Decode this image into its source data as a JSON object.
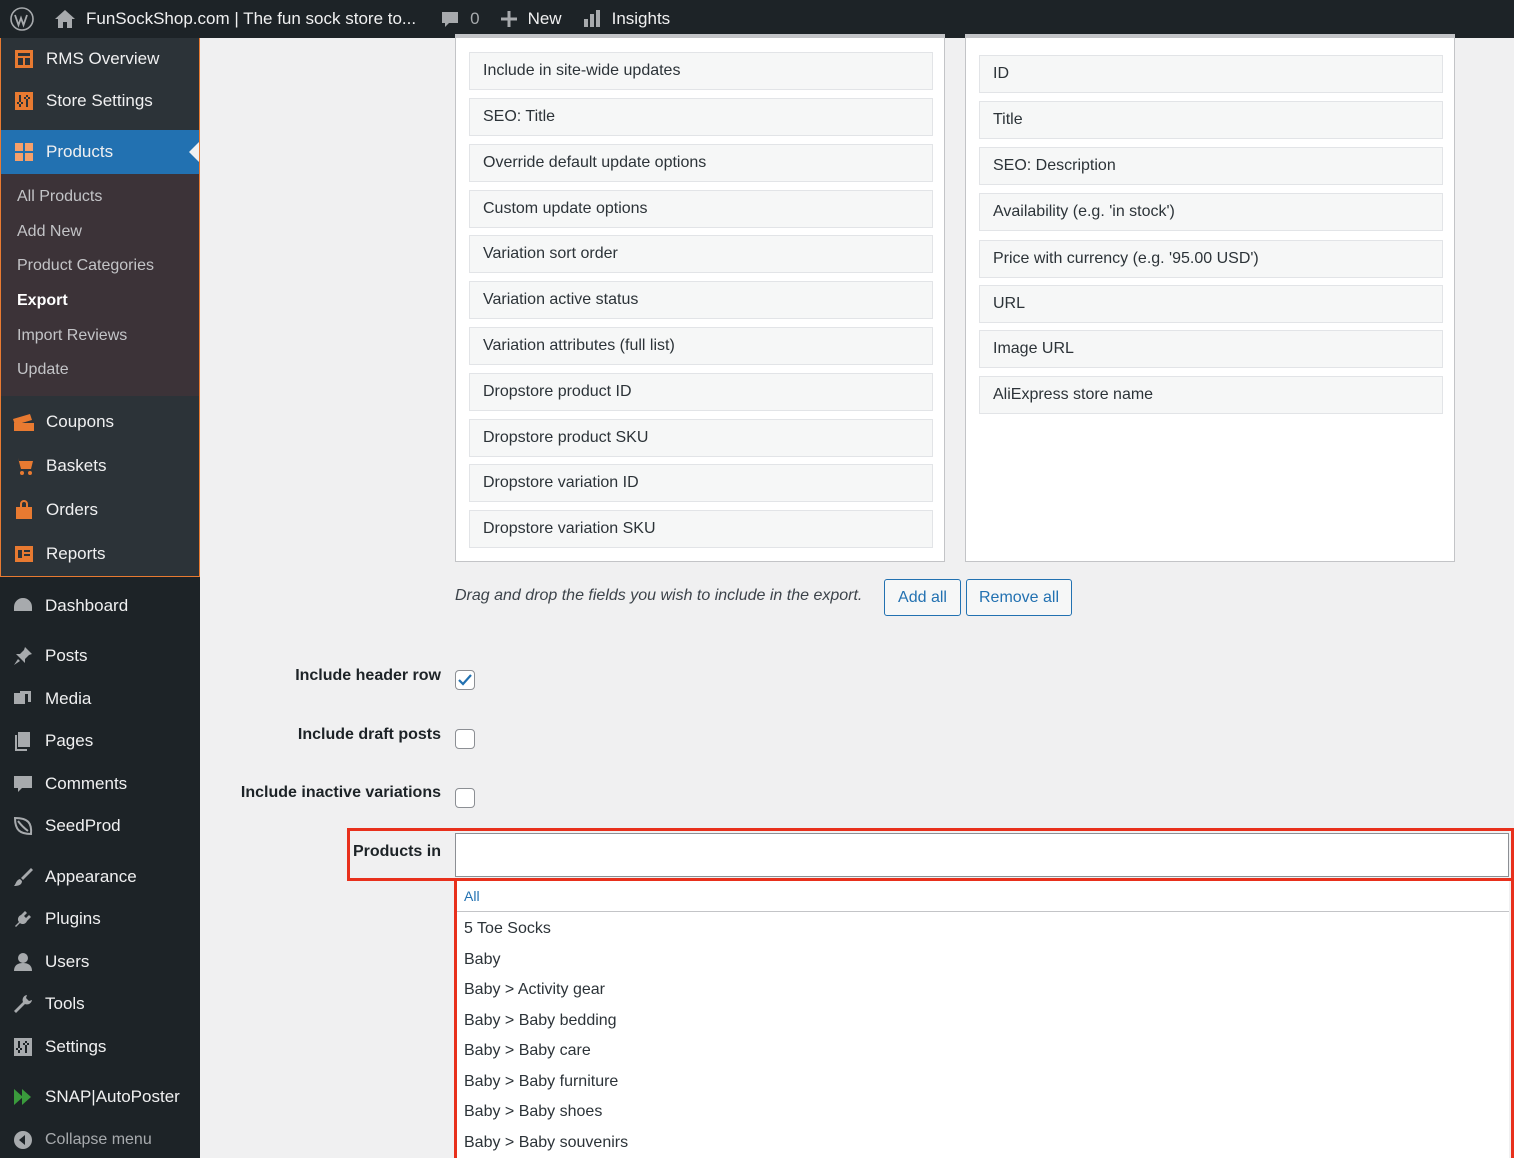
{
  "adminbar": {
    "site_title": "FunSockShop.com | The fun sock store to...",
    "comments_count": "0",
    "new_label": "New",
    "insights_label": "Insights"
  },
  "sidebar": {
    "rms_items": [
      {
        "label": "RMS Overview",
        "icon": "rms-overview-icon"
      },
      {
        "label": "Store Settings",
        "icon": "store-settings-icon"
      }
    ],
    "products": {
      "label": "Products",
      "submenu": [
        "All Products",
        "Add New",
        "Product Categories",
        "Export",
        "Import Reviews",
        "Update"
      ],
      "current_submenu": "Export"
    },
    "rms_items_after": [
      {
        "label": "Coupons",
        "icon": "coupons-icon"
      },
      {
        "label": "Baskets",
        "icon": "baskets-icon"
      },
      {
        "label": "Orders",
        "icon": "orders-icon"
      },
      {
        "label": "Reports",
        "icon": "reports-icon"
      }
    ],
    "wp_items": [
      "Dashboard",
      "Posts",
      "Media",
      "Pages",
      "Comments",
      "SeedProd",
      "Appearance",
      "Plugins",
      "Users",
      "Tools",
      "Settings",
      "SNAP|AutoPoster"
    ],
    "collapse_label": "Collapse menu"
  },
  "available_fields": [
    "Include in site-wide updates",
    "SEO: Title",
    "Override default update options",
    "Custom update options",
    "Variation sort order",
    "Variation active status",
    "Variation attributes (full list)",
    "Dropstore product ID",
    "Dropstore product SKU",
    "Dropstore variation ID",
    "Dropstore variation SKU"
  ],
  "selected_fields": [
    "ID",
    "Title",
    "SEO: Description",
    "Availability (e.g. 'in stock')",
    "Price with currency (e.g. '95.00 USD')",
    "URL",
    "Image URL",
    "AliExpress store name"
  ],
  "hint": "Drag and drop the fields you wish to include in the export.",
  "buttons": {
    "add_all": "Add all",
    "remove_all": "Remove all"
  },
  "options": {
    "include_header_row": {
      "label": "Include header row",
      "checked": true
    },
    "include_draft_posts": {
      "label": "Include draft posts",
      "checked": false
    },
    "include_inactive_variations": {
      "label": "Include inactive variations",
      "checked": false
    }
  },
  "products_in": {
    "label": "Products in",
    "value": "",
    "dropdown_all": "All",
    "options": [
      "5 Toe Socks",
      "Baby",
      "Baby > Activity gear",
      "Baby > Baby bedding",
      "Baby > Baby care",
      "Baby > Baby furniture",
      "Baby > Baby shoes",
      "Baby > Baby souvenirs"
    ]
  },
  "colors": {
    "accent": "#2271b1",
    "highlight": "#e8301c",
    "rms_orange": "#e87a31",
    "sidebar": "#1d2327"
  }
}
